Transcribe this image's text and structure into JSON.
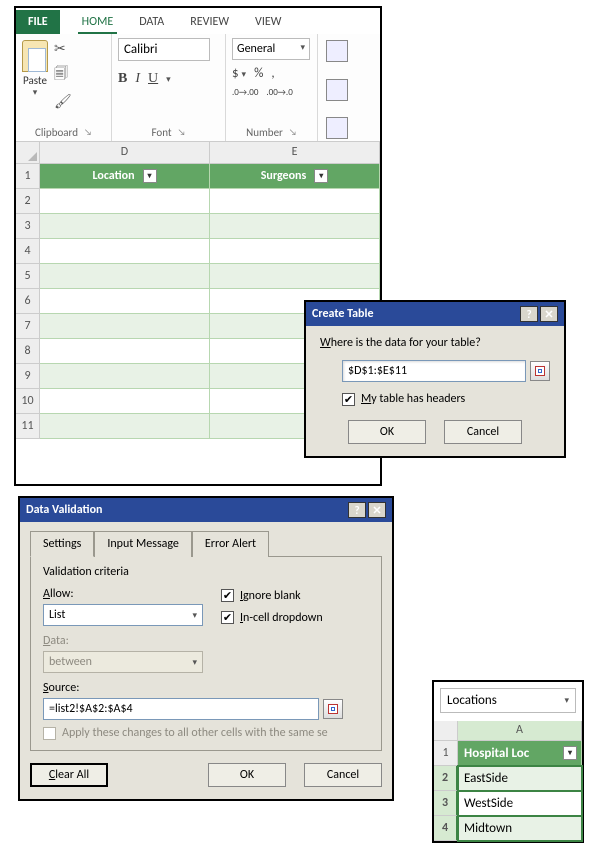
{
  "ribbon": {
    "tabs": {
      "file": "FILE",
      "home": "HOME",
      "data": "DATA",
      "review": "REVIEW",
      "view": "VIEW"
    },
    "clipboard": {
      "paste": "Paste",
      "label": "Clipboard"
    },
    "font": {
      "name": "Calibri",
      "label": "Font",
      "bold": "B",
      "italic": "I",
      "underline": "U"
    },
    "number": {
      "format": "General",
      "label": "Number"
    }
  },
  "columns": {
    "d": "D",
    "e": "E"
  },
  "table_headers": {
    "location": "Location",
    "surgeons": "Surgeons"
  },
  "rows": [
    "1",
    "2",
    "3",
    "4",
    "5",
    "6",
    "7",
    "8",
    "9",
    "10",
    "11"
  ],
  "create_table": {
    "title": "Create Table",
    "question_pre": "W",
    "question_rest": "here is the data for your table?",
    "range": "$D$1:$E$11",
    "has_headers_pre": "M",
    "has_headers_rest": "y table has headers",
    "ok": "OK",
    "cancel": "Cancel"
  },
  "data_validation": {
    "title": "Data Validation",
    "tabs": {
      "settings": "Settings",
      "input_message": "Input Message",
      "error_alert": "Error Alert"
    },
    "criteria_label": "Validation criteria",
    "allow_label": "Allow:",
    "allow_value": "List",
    "data_label": "Data:",
    "data_value": "between",
    "ignore_blank": "Ignore blank",
    "in_cell": "In-cell dropdown",
    "source_label": "Source:",
    "source_value": "=list2!$A$2:$A$4",
    "apply_text": "Apply these changes to all other cells with the same se",
    "clear_all": "Clear All",
    "ok": "OK",
    "cancel": "Cancel"
  },
  "mini": {
    "namebox": "Locations",
    "col": "A",
    "header": "Hospital Loc",
    "rows": [
      {
        "n": "1"
      },
      {
        "n": "2",
        "v": "EastSide"
      },
      {
        "n": "3",
        "v": "WestSide"
      },
      {
        "n": "4",
        "v": "Midtown"
      }
    ]
  }
}
